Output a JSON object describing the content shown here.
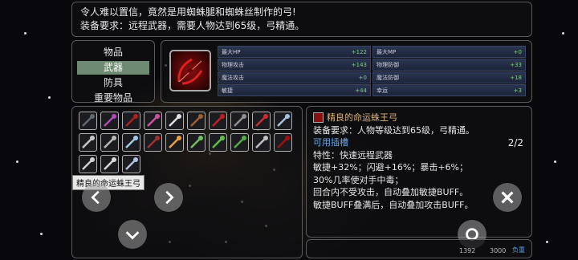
{
  "description": {
    "line1": "令人难以置信，竟然是用蜘蛛腿和蜘蛛丝制作的弓!",
    "line2": "装备要求：远程武器，需要人物达到65级，弓精通。"
  },
  "categories": [
    {
      "label": "物品",
      "selected": false
    },
    {
      "label": "武器",
      "selected": true
    },
    {
      "label": "防具",
      "selected": false
    },
    {
      "label": "重要物品",
      "selected": false
    }
  ],
  "stats": [
    [
      {
        "label": "最大HP",
        "value": "+122"
      },
      {
        "label": "最大MP",
        "value": "+0"
      }
    ],
    [
      {
        "label": "物理攻击",
        "value": "+143"
      },
      {
        "label": "物理防御",
        "value": "+33"
      }
    ],
    [
      {
        "label": "魔法攻击",
        "value": "+0"
      },
      {
        "label": "魔法防御",
        "value": "+18"
      }
    ],
    [
      {
        "label": "敏捷",
        "value": "+44"
      },
      {
        "label": "幸运",
        "value": "+3"
      }
    ]
  ],
  "inventory": [
    {
      "icon": "dark-sword-icon",
      "color": "#606870"
    },
    {
      "icon": "purple-staff-icon",
      "color": "#b04ab8"
    },
    {
      "icon": "red-axe-icon",
      "color": "#b02020"
    },
    {
      "icon": "pink-staff-icon",
      "color": "#d050a0"
    },
    {
      "icon": "double-axe-icon",
      "color": "#e0e0e0"
    },
    {
      "icon": "wooden-staff-icon",
      "color": "#a0602a"
    },
    {
      "icon": "red-hammer-icon",
      "color": "#c02020"
    },
    {
      "icon": "grey-hammer-icon",
      "color": "#909090"
    },
    {
      "icon": "red-mace-icon",
      "color": "#c83030"
    },
    {
      "icon": "blue-sword-icon",
      "color": "#a8c0e0"
    },
    {
      "icon": "silver-sword-icon",
      "color": "#c8c8c8"
    },
    {
      "icon": "steel-sword-icon",
      "color": "#b8b8b8"
    },
    {
      "icon": "blue-blade-icon",
      "color": "#a0c8e8"
    },
    {
      "icon": "dark-spear-icon",
      "color": "#a03030"
    },
    {
      "icon": "flame-sword-icon",
      "color": "#e8a040"
    },
    {
      "icon": "jade-sword-icon",
      "color": "#70c060"
    },
    {
      "icon": "green-flail-icon",
      "color": "#60c040"
    },
    {
      "icon": "green-mace-icon",
      "color": "#50b040"
    },
    {
      "icon": "silver-wand-icon",
      "color": "#c0c0c0"
    },
    {
      "icon": "spider-bow-icon",
      "color": "#a01010"
    },
    {
      "icon": "long-spear-icon",
      "color": "#d0d0d0"
    },
    {
      "icon": "silver-bow-icon",
      "color": "#d8d8d8"
    },
    {
      "icon": "wing-bow-icon",
      "color": "#b0c0e0"
    }
  ],
  "tooltip": "精良的命运蛛王弓",
  "detail": {
    "name": "精良的命运蛛王弓",
    "requirement": "装备要求：人物等级达到65级，弓精通。",
    "socket": "可用插槽",
    "count": "2/2",
    "trait": "特性：快速远程武器",
    "line1": "敏捷+32%；闪避+16%；暴击+6%；",
    "line2": "30%几率使对手中毒；",
    "line3": "回合内不受攻击，自动叠加敏捷BUFF。",
    "line4": "敏捷BUFF叠满后，自动叠加攻击BUFF。"
  },
  "footer": {
    "current": "1392",
    "max": "3000",
    "load_label": "负重"
  },
  "colors": {
    "selected_category": "#6f8a72",
    "stat_value": "#7fcf7f",
    "item_name": "#d9b27a",
    "socket_text": "#6aa6e6"
  }
}
